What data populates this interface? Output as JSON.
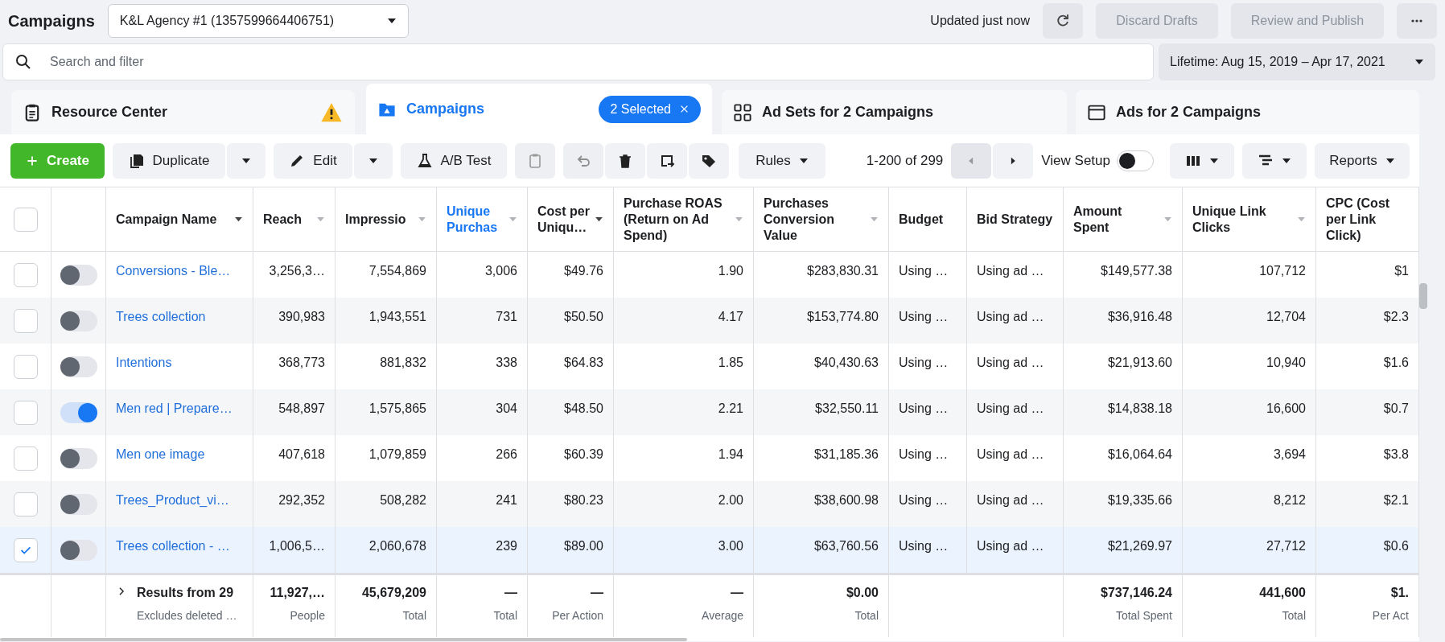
{
  "header": {
    "title": "Campaigns",
    "account": "K&L Agency #1 (1357599664406751)",
    "updated": "Updated just now",
    "discard": {
      "label": "Discard Drafts",
      "disabled": true
    },
    "publish": {
      "label": "Review and Publish",
      "disabled": true
    }
  },
  "search": {
    "placeholder": "Search and filter"
  },
  "date_range": "Lifetime: Aug 15, 2019 – Apr 17, 2021",
  "tabs": [
    {
      "label": "Resource Center",
      "selected": false,
      "warning": true
    },
    {
      "label": "Campaigns",
      "selected": true,
      "chip": "2 Selected"
    },
    {
      "label": "Ad Sets for 2 Campaigns",
      "selected": false
    },
    {
      "label": "Ads for 2 Campaigns",
      "selected": false
    }
  ],
  "toolbar": {
    "create": "Create",
    "duplicate": "Duplicate",
    "edit": "Edit",
    "ab_test": "A/B Test",
    "clipboard_disabled": true,
    "undo_disabled": true,
    "rules": "Rules",
    "pagination": "1-200 of 299",
    "prev_disabled": true,
    "next_disabled": false,
    "view_setup": {
      "label": "View Setup",
      "on": false
    },
    "reports": "Reports"
  },
  "table": {
    "select_all": {
      "checked": false
    },
    "columns": [
      {
        "label": "Campaign Name",
        "kind": "name",
        "sortable": true,
        "highlighted": false
      },
      {
        "label": "Reach",
        "kind": "number",
        "sortable": true,
        "highlighted": false
      },
      {
        "label": "Impressio",
        "kind": "number",
        "sortable": true,
        "highlighted": false
      },
      {
        "label": "Unique Purchas",
        "kind": "number",
        "sortable": true,
        "highlighted": true
      },
      {
        "label": "Cost per Uniqu…",
        "kind": "number",
        "sortable": true,
        "highlighted": false
      },
      {
        "label": "Purchase ROAS (Return on Ad Spend)",
        "kind": "number",
        "sortable": true,
        "highlighted": false
      },
      {
        "label": "Purchases Conversion Value",
        "kind": "number",
        "sortable": true,
        "highlighted": false
      },
      {
        "label": "Budget",
        "kind": "text",
        "sortable": false,
        "highlighted": false
      },
      {
        "label": "Bid Strategy",
        "kind": "text",
        "sortable": false,
        "highlighted": false
      },
      {
        "label": "Amount Spent",
        "kind": "number",
        "sortable": true,
        "highlighted": false
      },
      {
        "label": "Unique Link Clicks",
        "kind": "number",
        "sortable": true,
        "highlighted": false
      },
      {
        "label": "CPC (Cost per Link Click)",
        "kind": "number",
        "sortable": false,
        "highlighted": false
      }
    ],
    "rows": [
      {
        "selected": false,
        "on": false,
        "cells": [
          "Conversions - Ble…",
          "3,256,3…",
          "7,554,869",
          "3,006",
          "$49.76",
          "1.90",
          "$283,830.31",
          "Using …",
          "Using ad …",
          "$149,577.38",
          "107,712",
          "$1"
        ]
      },
      {
        "selected": false,
        "on": false,
        "cells": [
          "Trees collection",
          "390,983",
          "1,943,551",
          "731",
          "$50.50",
          "4.17",
          "$153,774.80",
          "Using …",
          "Using ad …",
          "$36,916.48",
          "12,704",
          "$2.3"
        ]
      },
      {
        "selected": false,
        "on": false,
        "cells": [
          "Intentions",
          "368,773",
          "881,832",
          "338",
          "$64.83",
          "1.85",
          "$40,430.63",
          "Using …",
          "Using ad …",
          "$21,913.60",
          "10,940",
          "$1.6"
        ]
      },
      {
        "selected": false,
        "on": true,
        "cells": [
          "Men red | Prepare…",
          "548,897",
          "1,575,865",
          "304",
          "$48.50",
          "2.21",
          "$32,550.11",
          "Using …",
          "Using ad …",
          "$14,838.18",
          "16,600",
          "$0.7"
        ]
      },
      {
        "selected": false,
        "on": false,
        "cells": [
          "Men one image",
          "407,618",
          "1,079,859",
          "266",
          "$60.39",
          "1.94",
          "$31,185.36",
          "Using …",
          "Using ad …",
          "$16,064.64",
          "3,694",
          "$3.8"
        ]
      },
      {
        "selected": false,
        "on": false,
        "cells": [
          "Trees_Product_vi…",
          "292,352",
          "508,282",
          "241",
          "$80.23",
          "2.00",
          "$38,600.98",
          "Using …",
          "Using ad …",
          "$19,335.66",
          "8,212",
          "$2.1"
        ]
      },
      {
        "selected": true,
        "on": false,
        "cells": [
          "Trees collection - …",
          "1,006,5…",
          "2,060,678",
          "239",
          "$89.00",
          "3.00",
          "$63,760.56",
          "Using …",
          "Using ad …",
          "$21,269.97",
          "27,712",
          "$0.6"
        ]
      }
    ],
    "footer": {
      "title": "Results from 29",
      "note": "Excludes deleted …",
      "cells": [
        {
          "value": "11,927,…",
          "sub": "People"
        },
        {
          "value": "45,679,209",
          "sub": "Total"
        },
        {
          "value": "—",
          "sub": "Total"
        },
        {
          "value": "—",
          "sub": "Per Action"
        },
        {
          "value": "—",
          "sub": "Average"
        },
        {
          "value": "$0.00",
          "sub": "Total"
        },
        null,
        null,
        {
          "value": "$737,146.24",
          "sub": "Total Spent"
        },
        {
          "value": "441,600",
          "sub": "Total"
        },
        {
          "value": "$1.",
          "sub": "Per Act"
        }
      ]
    }
  }
}
